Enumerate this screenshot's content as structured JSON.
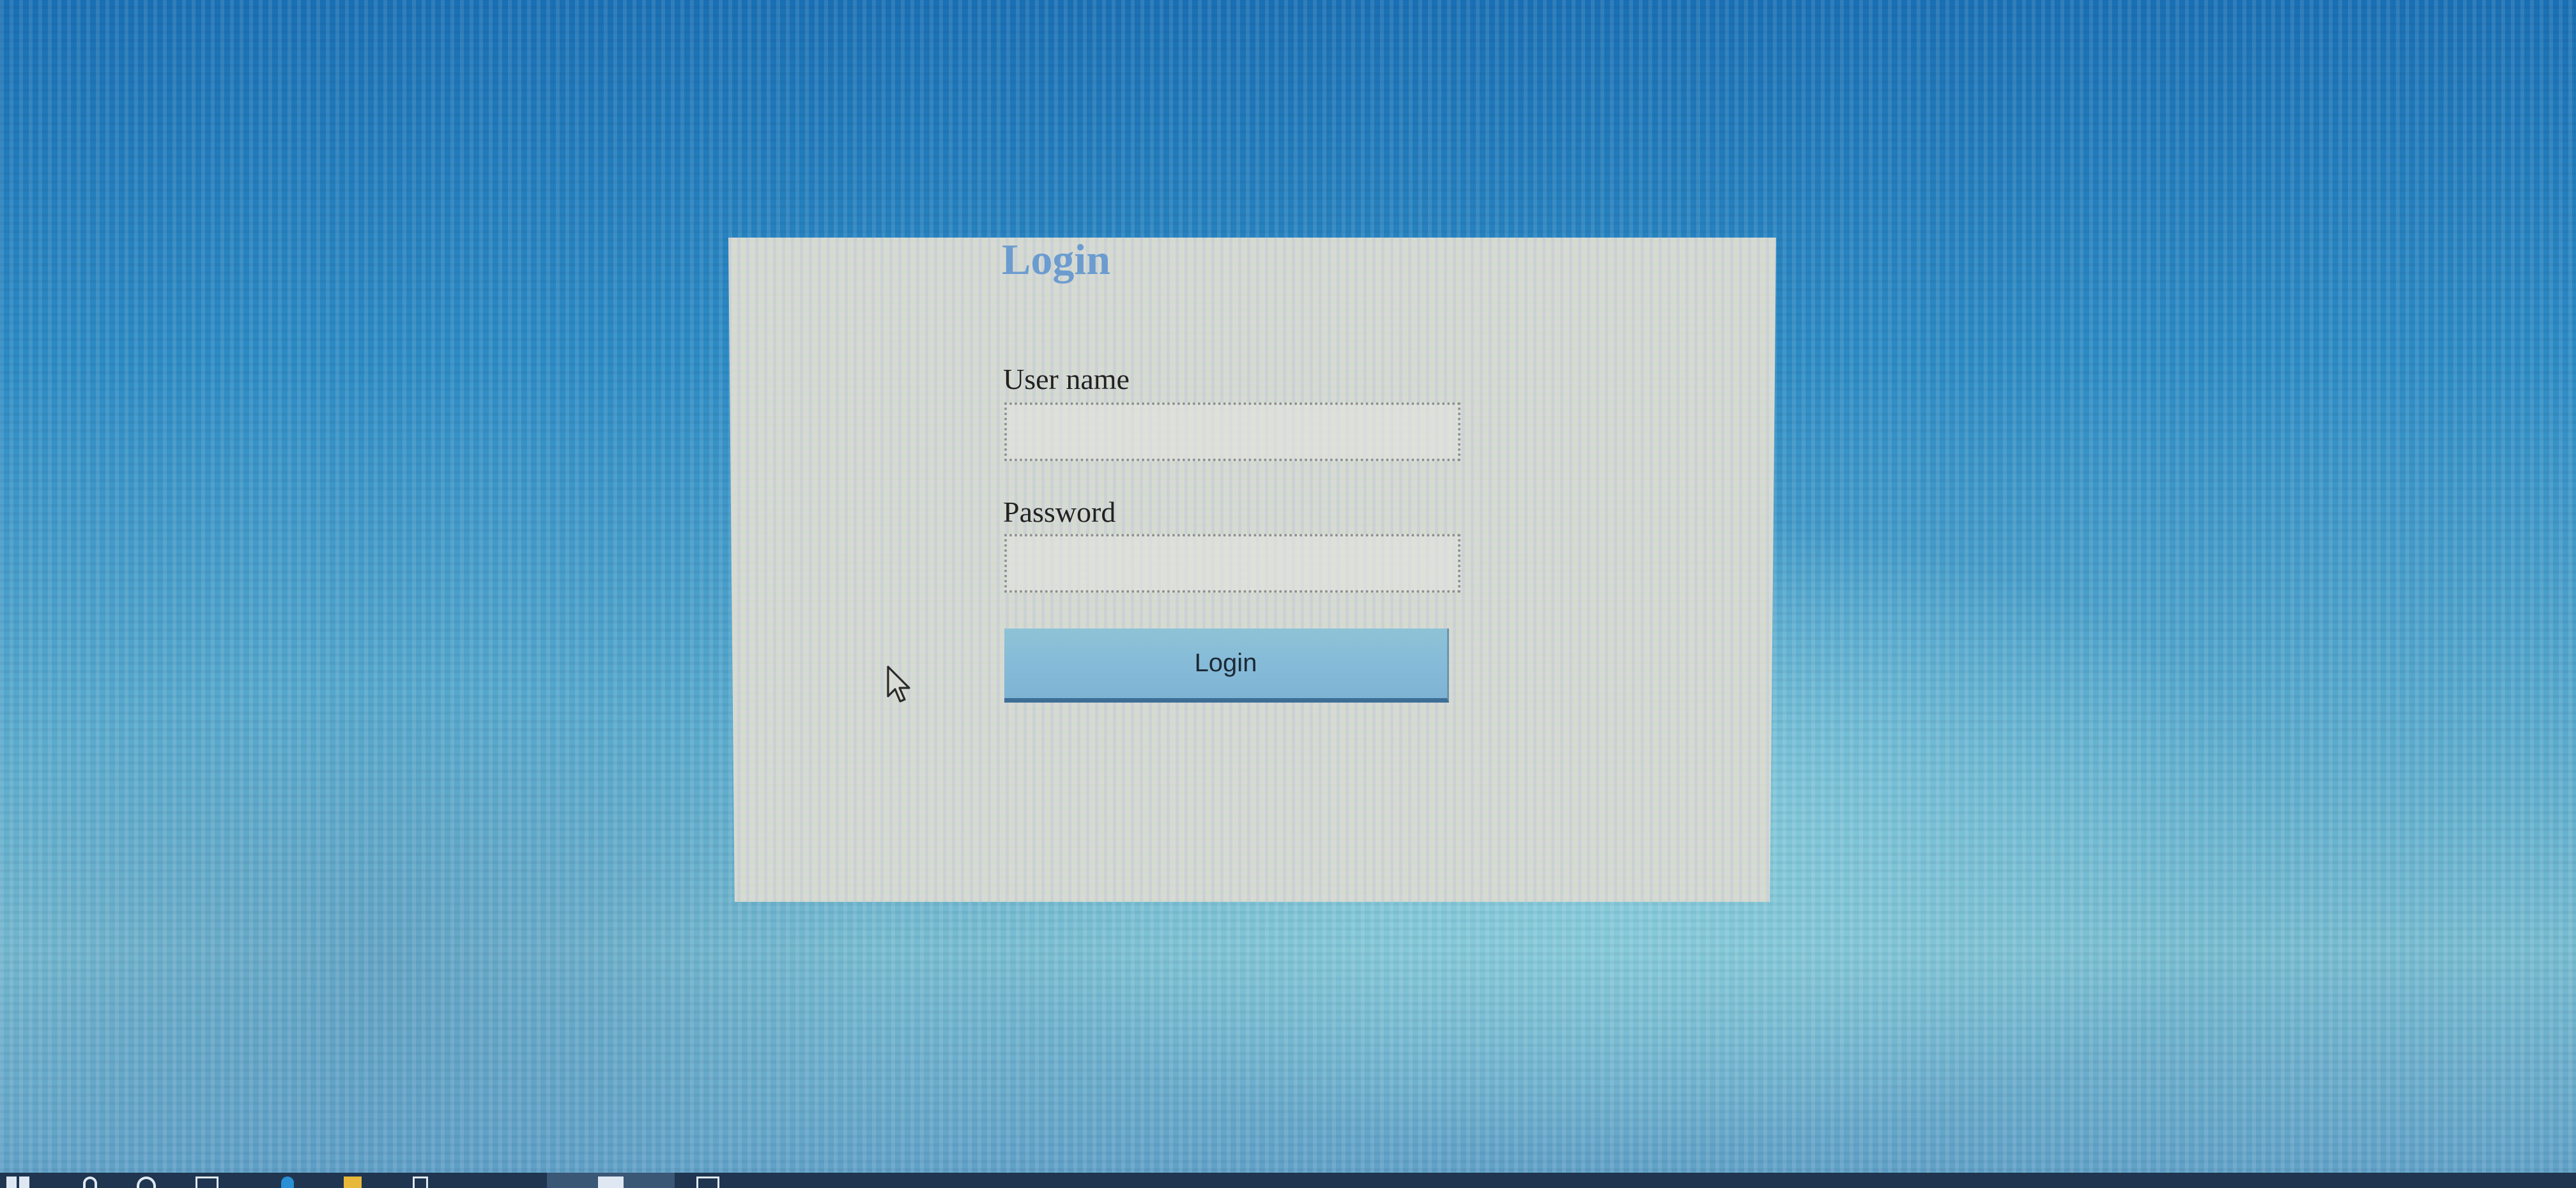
{
  "login_form": {
    "title": "Login",
    "username": {
      "label": "User name",
      "value": "",
      "placeholder": ""
    },
    "password": {
      "label": "Password",
      "value": "",
      "placeholder": ""
    },
    "submit_label": "Login"
  },
  "colors": {
    "desktop_background": "#2d8bc4",
    "panel_background": "#d7dad3",
    "title_text": "#6c9ccf",
    "button_background": "#86bbd8",
    "taskbar": "#1f3550"
  },
  "taskbar": {
    "icons": [
      "start-icon",
      "search-icon",
      "cortana-icon",
      "task-view-icon",
      "edge-icon",
      "file-explorer-icon",
      "app-icon",
      "active-app-icon",
      "app-icon"
    ]
  }
}
